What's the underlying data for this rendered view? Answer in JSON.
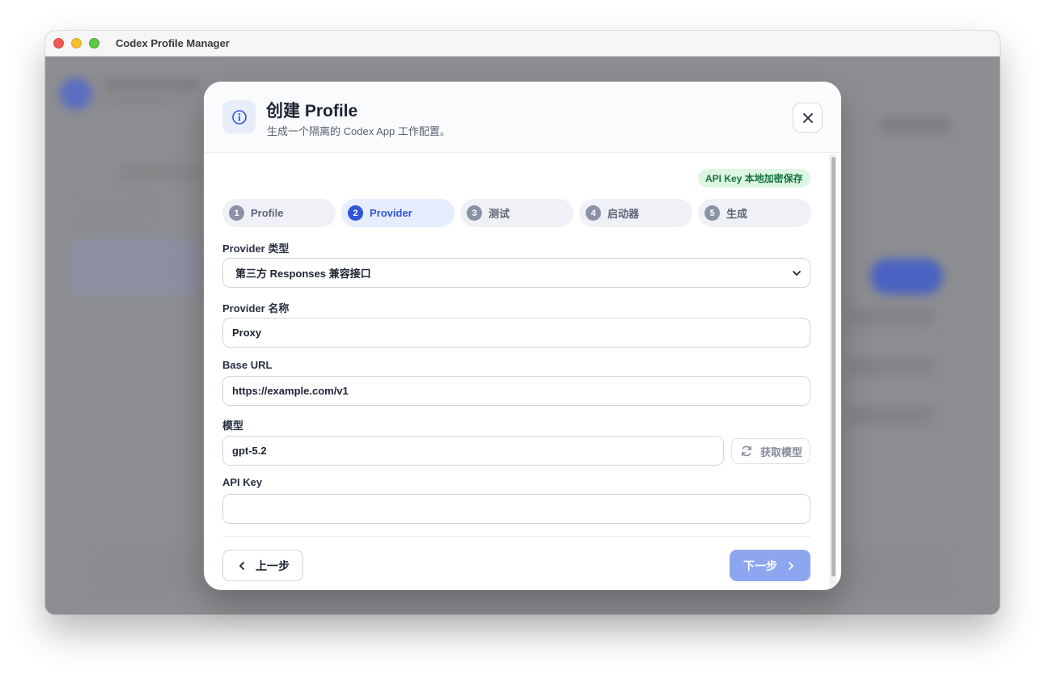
{
  "window": {
    "title": "Codex Profile Manager"
  },
  "modal": {
    "title": "创建 Profile",
    "subtitle": "生成一个隔离的 Codex App 工作配置。",
    "close_icon": "close-icon",
    "info_icon": "info-icon"
  },
  "security_badge": "API Key 本地加密保存",
  "steps": [
    {
      "num": "1",
      "label": "Profile",
      "active": false
    },
    {
      "num": "2",
      "label": "Provider",
      "active": true
    },
    {
      "num": "3",
      "label": "测试",
      "active": false
    },
    {
      "num": "4",
      "label": "启动器",
      "active": false
    },
    {
      "num": "5",
      "label": "生成",
      "active": false
    }
  ],
  "form": {
    "provider_type": {
      "label": "Provider 类型",
      "value": "第三方 Responses 兼容接口"
    },
    "provider_name": {
      "label": "Provider 名称",
      "value": "Proxy"
    },
    "base_url": {
      "label": "Base URL",
      "value": "https://example.com/v1"
    },
    "model": {
      "label": "模型",
      "value": "gpt-5.2",
      "fetch_label": "获取模型"
    },
    "api_key": {
      "label": "API Key",
      "value": ""
    }
  },
  "footer": {
    "prev_label": "上一步",
    "next_label": "下一步"
  },
  "colors": {
    "accent": "#2f56d8",
    "next_button": "#8da6ef",
    "badge_bg": "#dcf6e3",
    "badge_text": "#17723a"
  }
}
